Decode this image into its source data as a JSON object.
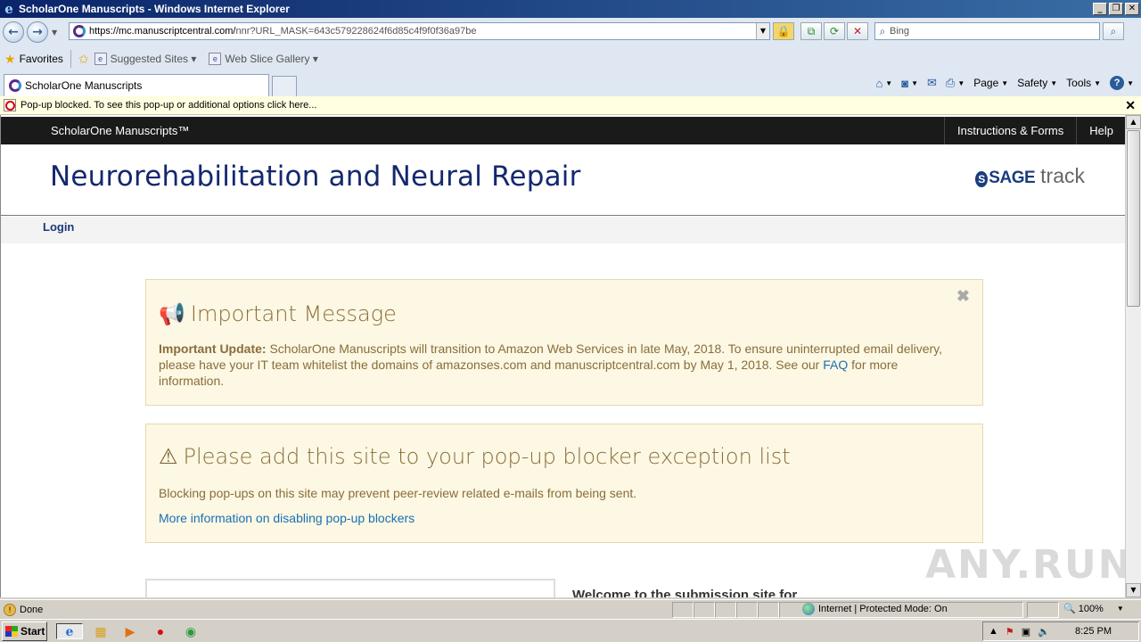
{
  "window": {
    "title": "ScholarOne Manuscripts - Windows Internet Explorer",
    "btn_min": "_",
    "btn_restore": "❐",
    "btn_close": "✕"
  },
  "address": {
    "url_host": "https://mc.manuscriptcentral.com/",
    "url_rest": "nnr?URL_MASK=643c579228624f6d85c4f9f0f36a97be",
    "search_placeholder": "Bing"
  },
  "favorites": {
    "label": "Favorites",
    "links": [
      "Suggested Sites ▾",
      "Web Slice Gallery ▾"
    ]
  },
  "tabs": {
    "active": "ScholarOne Manuscripts"
  },
  "commandbar": {
    "page": "Page",
    "safety": "Safety",
    "tools": "Tools"
  },
  "popup_bar": {
    "text": "Pop-up blocked. To see this pop-up or additional options click here..."
  },
  "site": {
    "brand": "ScholarOne Manuscripts™",
    "nav": [
      "Instructions & Forms",
      "Help"
    ],
    "journal_title": "Neurorehabilitation and Neural Repair",
    "logo_sage": "SAGE",
    "logo_track": "track",
    "login": "Login"
  },
  "message1": {
    "heading": "Important Message",
    "lead": "Important Update:",
    "body": " ScholarOne Manuscripts will transition to Amazon Web Services in late May, 2018. To ensure uninterrupted email delivery, please have your IT team whitelist the domains of amazonses.com and manuscriptcentral.com by May 1, 2018. See our ",
    "faq": "FAQ",
    "tail": " for more information."
  },
  "message2": {
    "heading": "Please add this site to your pop-up blocker exception list",
    "body": "Blocking pop-ups on this site may prevent peer-review related e-mails from being sent.",
    "link": "More information on disabling pop-up blockers"
  },
  "welcome": "Welcome to the submission site for",
  "statusbar": {
    "status": "Done",
    "zone": "Internet | Protected Mode: On",
    "zoom": "100%"
  },
  "taskbar": {
    "start": "Start",
    "clock": "8:25 PM"
  },
  "watermark": "ANY.RUN"
}
